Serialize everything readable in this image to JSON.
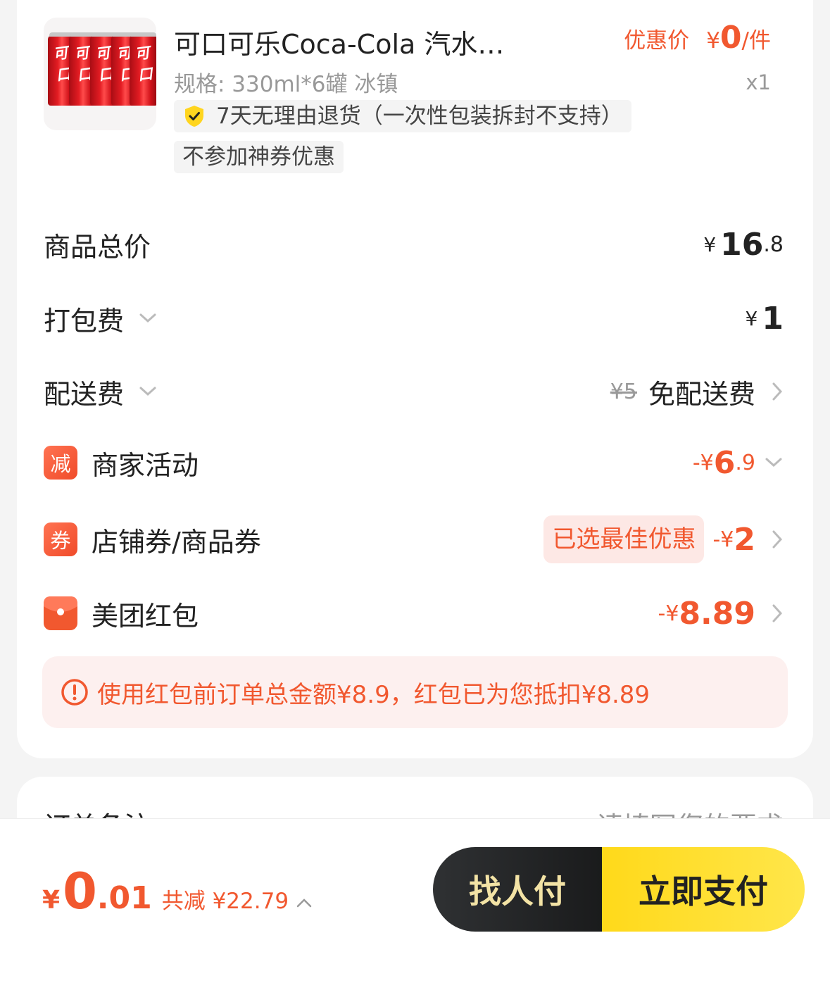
{
  "product": {
    "title": "可口可乐Coca-Cola 汽水…",
    "spec": "规格: 330ml*6罐 冰镇",
    "price_label": "优惠价",
    "price_currency": "¥",
    "price_value": "0",
    "price_unit": "/件",
    "quantity": "x1",
    "can_text": "可口",
    "tag_return": "7天无理由退货（一次性包装拆封不支持）",
    "tag_nocoupon": "不参加神券优惠",
    "image_icon": "coca-cola-cans-image"
  },
  "fees": {
    "goods_total_label": "商品总价",
    "goods_total_currency": "¥",
    "goods_total_int": "16",
    "goods_total_dec": ".8",
    "packing_label": "打包费",
    "packing_currency": "¥",
    "packing_int": "1",
    "delivery_label": "配送费",
    "delivery_original": "¥5",
    "delivery_value": "免配送费",
    "merchant_badge": "减",
    "merchant_label": "商家活动",
    "merchant_value_prefix": "-¥",
    "merchant_value_int": "6",
    "merchant_value_dec": ".9",
    "coupon_badge": "券",
    "coupon_label": "店铺券/商品券",
    "coupon_best": "已选最佳优惠",
    "coupon_value_prefix": "-¥",
    "coupon_value_int": "2",
    "redpack_label": "美团红包",
    "redpack_value_prefix": "-¥",
    "redpack_value_int": "8.89"
  },
  "notice": {
    "text": "使用红包前订单总金额¥8.9，红包已为您抵扣¥8.89"
  },
  "remarks": {
    "label": "订单备注",
    "placeholder": "请填写您的要求"
  },
  "bottom": {
    "currency": "¥",
    "total_int": "0",
    "total_dec": ".01",
    "saved_text": "共减 ¥22.79",
    "find_pay_label": "找人付",
    "pay_label": "立即支付"
  },
  "colors": {
    "accent": "#f1582f",
    "pay_button": "#ffd91a",
    "dark_button": "#1a1b1c"
  }
}
